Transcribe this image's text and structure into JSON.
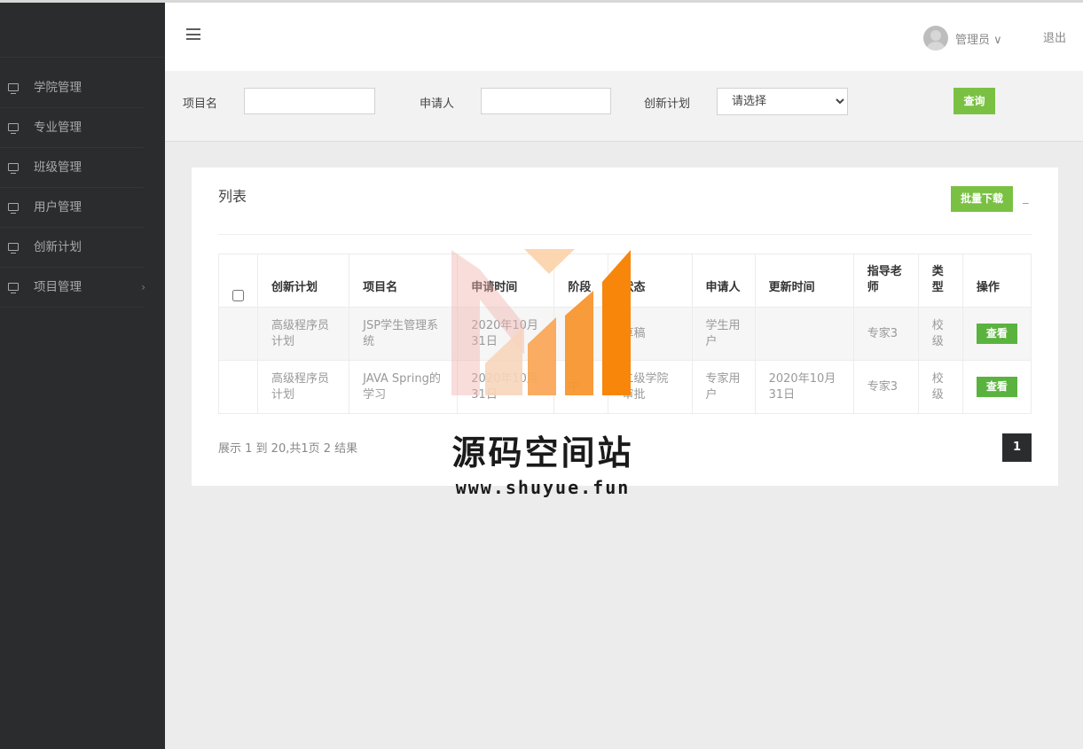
{
  "sidebar": {
    "items": [
      {
        "label": "学院管理"
      },
      {
        "label": "专业管理"
      },
      {
        "label": "班级管理"
      },
      {
        "label": "用户管理"
      },
      {
        "label": "创新计划"
      },
      {
        "label": "项目管理",
        "has_submenu": true
      }
    ],
    "chevron": "›"
  },
  "header": {
    "user": "管理员 ∨",
    "logout": "退出"
  },
  "search": {
    "project_label": "项目名",
    "project_value": "",
    "applicant_label": "申请人",
    "applicant_value": "",
    "plan_label": "创新计划",
    "plan_selected": "请选择",
    "query_button": "查询"
  },
  "list": {
    "title": "列表",
    "batch_download": "批量下载",
    "collapse": "_",
    "columns": [
      "创新计划",
      "项目名",
      "申请时间",
      "阶段",
      "状态",
      "申请人",
      "更新时间",
      "指导老师",
      "类型",
      "操作"
    ],
    "rows": [
      {
        "plan": "高级程序员计划",
        "project": "JSP学生管理系统",
        "apply_time": "2020年10月31日",
        "stage": "",
        "status": "草稿",
        "applicant": "学生用户",
        "update_time": "",
        "teacher": "专家3",
        "type": "校级",
        "action": "查看"
      },
      {
        "plan": "高级程序员计划",
        "project": "JAVA Spring的学习",
        "apply_time": "2020年10月31日",
        "stage": "中",
        "status": "二级学院审批",
        "applicant": "专家用户",
        "update_time": "2020年10月31日",
        "teacher": "专家3",
        "type": "校级",
        "action": "查看"
      }
    ],
    "pager_info": "展示 1 到 20,共1页 2 结果",
    "current_page": "1"
  },
  "watermark": {
    "title": "源码空间站",
    "url": "www.shuyue.fun"
  },
  "colors": {
    "sidebar_bg": "#2b2c2e",
    "accent_green": "#7ac143",
    "view_green": "#5ab33e",
    "watermark_orange": "#f7860a"
  }
}
